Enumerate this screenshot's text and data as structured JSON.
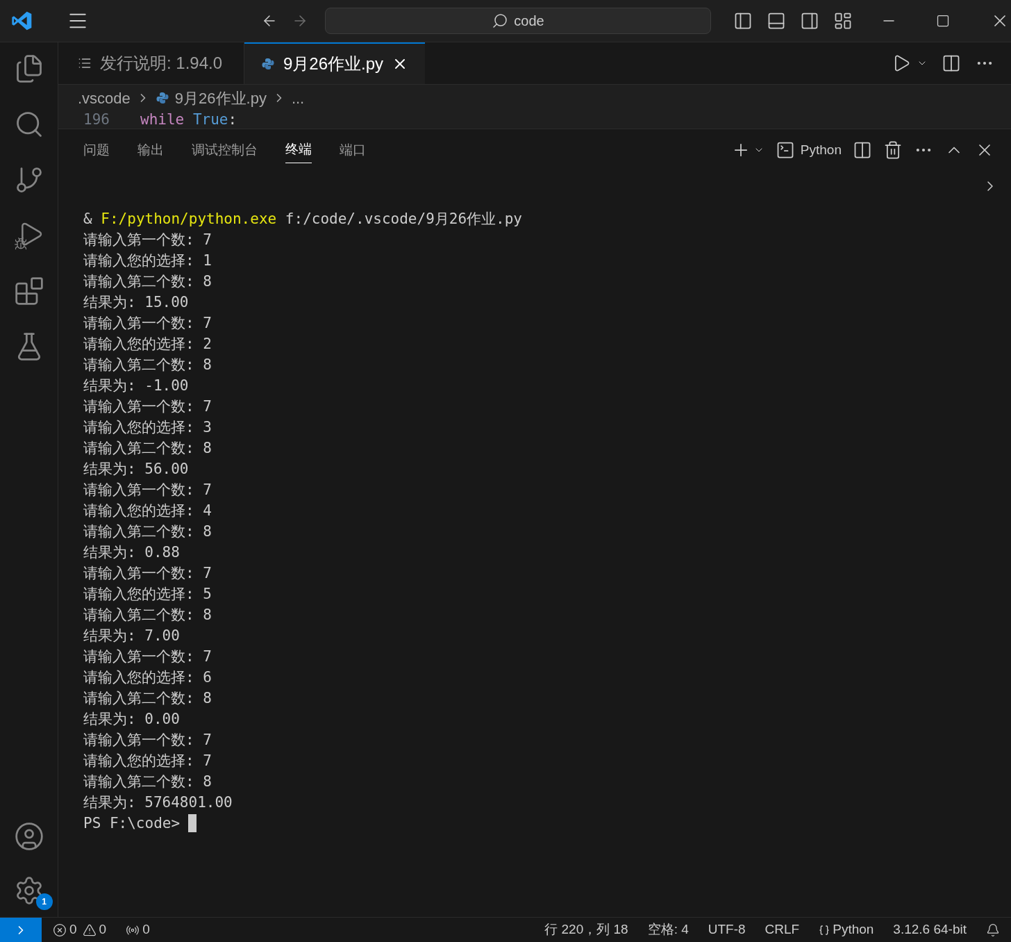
{
  "title_bar": {
    "search": "code"
  },
  "editor_tabs": [
    {
      "label": "发行说明: 1.94.0",
      "kind": "doc",
      "selected": false
    },
    {
      "label": "9月26作业.py",
      "kind": "python",
      "selected": true
    }
  ],
  "breadcrumb": [
    ".vscode",
    "9月26作业.py",
    "..."
  ],
  "editor_line": {
    "number": "196",
    "keyword": "while",
    "value": "True",
    "punct": ":"
  },
  "panel_tabs": [
    {
      "label": "问题",
      "selected": false
    },
    {
      "label": "输出",
      "selected": false
    },
    {
      "label": "调试控制台",
      "selected": false
    },
    {
      "label": "终端",
      "selected": true
    },
    {
      "label": "端口",
      "selected": false
    }
  ],
  "terminal_profile": "Python",
  "command": {
    "prefix": "&",
    "exe": "F:/python/python.exe",
    "args": "f:/code/.vscode/9月26作业.py"
  },
  "output": [
    "请输入第一个数: 7",
    "请输入您的选择: 1",
    "请输入第二个数: 8",
    "结果为: 15.00",
    "请输入第一个数: 7",
    "请输入您的选择: 2",
    "请输入第二个数: 8",
    "结果为: -1.00",
    "请输入第一个数: 7",
    "请输入您的选择: 3",
    "请输入第二个数: 8",
    "结果为: 56.00",
    "请输入第一个数: 7",
    "请输入您的选择: 4",
    "请输入第二个数: 8",
    "结果为: 0.88",
    "请输入第一个数: 7",
    "请输入您的选择: 5",
    "请输入第二个数: 8",
    "结果为: 7.00",
    "请输入第一个数: 7",
    "请输入您的选择: 6",
    "请输入第二个数: 8",
    "结果为: 0.00",
    "请输入第一个数: 7",
    "请输入您的选择: 7",
    "请输入第二个数: 8",
    "结果为: 5764801.00"
  ],
  "prompt": "PS F:\\code>",
  "settings_badge": "1",
  "status_bar": {
    "errors": "0",
    "warnings": "0",
    "ports": "0",
    "right": [
      {
        "kind": "text",
        "label": "行 220，列 18"
      },
      {
        "kind": "text",
        "label": "空格: 4"
      },
      {
        "kind": "text",
        "label": "UTF-8"
      },
      {
        "kind": "text",
        "label": "CRLF"
      },
      {
        "kind": "language",
        "label": "Python"
      },
      {
        "kind": "text",
        "label": "3.12.6 64-bit"
      }
    ]
  }
}
